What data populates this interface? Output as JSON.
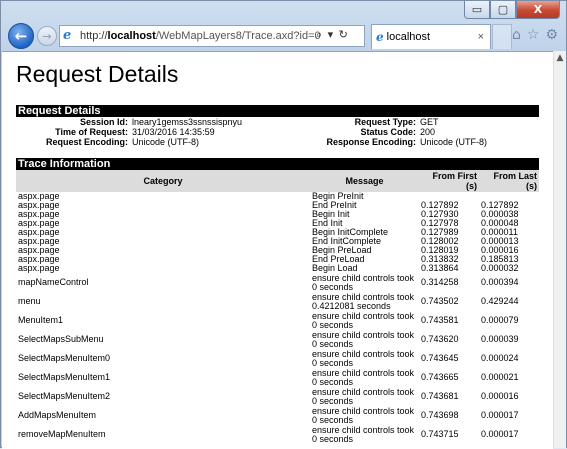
{
  "window": {
    "buttons": {
      "minimize": "▭",
      "maximize": "▢",
      "close": "X"
    }
  },
  "browser": {
    "address_prefix": "http://",
    "address_host": "localhost",
    "address_rest": "/WebMapLayers8/Trace.axd?id=0",
    "address_tools": "⌕ ▾ ↻",
    "tab_title": "localhost",
    "tab_close": "×",
    "icons": [
      "home-icon",
      "favorites-icon",
      "tools-icon"
    ]
  },
  "page": {
    "title": "Request Details",
    "request_details": {
      "header": "Request Details",
      "rows": [
        {
          "k1": "Session Id:",
          "v1": "lneary1gemss3ssnssispnyu",
          "k2": "Request Type:",
          "v2": "GET"
        },
        {
          "k1": "Time of Request:",
          "v1": "31/03/2016 14:35:59",
          "k2": "Status Code:",
          "v2": "200"
        },
        {
          "k1": "Request Encoding:",
          "v1": "Unicode (UTF-8)",
          "k2": "Response Encoding:",
          "v2": "Unicode (UTF-8)"
        }
      ]
    },
    "trace": {
      "header": "Trace Information",
      "columns": [
        "Category",
        "Message",
        "From First (s)",
        "From Last (s)"
      ],
      "rows": [
        {
          "category": "aspx.page",
          "message": "Begin PreInit",
          "first": "",
          "last": ""
        },
        {
          "category": "aspx.page",
          "message": "End PreInit",
          "first": "0.127892",
          "last": "0.127892"
        },
        {
          "category": "aspx.page",
          "message": "Begin Init",
          "first": "0.127930",
          "last": "0.000038"
        },
        {
          "category": "aspx.page",
          "message": "End Init",
          "first": "0.127978",
          "last": "0.000048"
        },
        {
          "category": "aspx.page",
          "message": "Begin InitComplete",
          "first": "0.127989",
          "last": "0.000011"
        },
        {
          "category": "aspx.page",
          "message": "End InitComplete",
          "first": "0.128002",
          "last": "0.000013"
        },
        {
          "category": "aspx.page",
          "message": "Begin PreLoad",
          "first": "0.128019",
          "last": "0.000016"
        },
        {
          "category": "aspx.page",
          "message": "End PreLoad",
          "first": "0.313832",
          "last": "0.185813"
        },
        {
          "category": "aspx.page",
          "message": "Begin Load",
          "first": "0.313864",
          "last": "0.000032"
        },
        {
          "category": "mapNameControl",
          "message": "ensure child controls took 0 seconds",
          "first": "0.314258",
          "last": "0.000394"
        },
        {
          "category": "menu",
          "message": "ensure child controls took 0.4212081 seconds",
          "first": "0.743502",
          "last": "0.429244"
        },
        {
          "category": "MenuItem1",
          "message": "ensure child controls took 0 seconds",
          "first": "0.743581",
          "last": "0.000079"
        },
        {
          "category": "SelectMapsSubMenu",
          "message": "ensure child controls took 0 seconds",
          "first": "0.743620",
          "last": "0.000039"
        },
        {
          "category": "SelectMapsMenuItem0",
          "message": "ensure child controls took 0 seconds",
          "first": "0.743645",
          "last": "0.000024"
        },
        {
          "category": "SelectMapsMenuItem1",
          "message": "ensure child controls took 0 seconds",
          "first": "0.743665",
          "last": "0.000021"
        },
        {
          "category": "SelectMapsMenuItem2",
          "message": "ensure child controls took 0 seconds",
          "first": "0.743681",
          "last": "0.000016"
        },
        {
          "category": "AddMapsMenuItem",
          "message": "ensure child controls took 0 seconds",
          "first": "0.743698",
          "last": "0.000017"
        },
        {
          "category": "removeMapMenuItem",
          "message": "ensure child controls took 0 seconds",
          "first": "0.743715",
          "last": "0.000017"
        }
      ]
    }
  }
}
